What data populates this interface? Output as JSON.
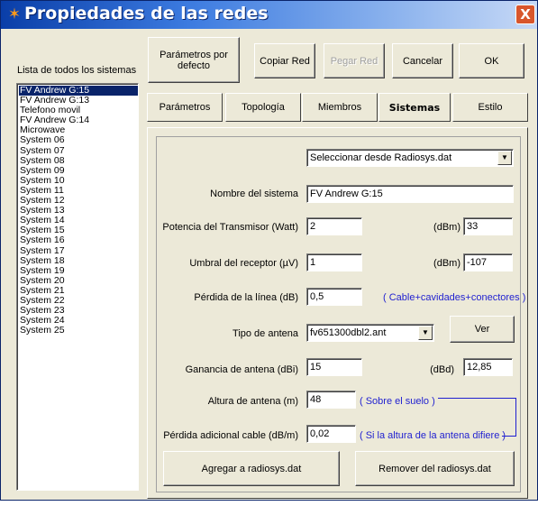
{
  "window": {
    "title": "Propiedades de las redes",
    "close_glyph": "X",
    "app_icon": "red-network-icon"
  },
  "toolbar": {
    "defaults_label": "Parámetros por defecto",
    "copy_label": "Copiar Red",
    "paste_label": "Pegar Red",
    "cancel_label": "Cancelar",
    "ok_label": "OK"
  },
  "systems_list": {
    "label": "Lista de todos los sistemas",
    "selected": "FV Andrew G:15",
    "items": [
      "FV Andrew G:15",
      "FV Andrew G:13",
      "Telefono movil",
      "FV Andrew G:14",
      "Microwave",
      "System 06",
      "System 07",
      "System 08",
      "System 09",
      "System 10",
      "System 11",
      "System 12",
      "System 13",
      "System 14",
      "System 15",
      "System 16",
      "System 17",
      "System 18",
      "System 19",
      "System 20",
      "System 21",
      "System 22",
      "System 23",
      "System 24",
      "System 25"
    ]
  },
  "tabs": [
    {
      "label": "Parámetros"
    },
    {
      "label": "Topología"
    },
    {
      "label": "Miembros"
    },
    {
      "label": "Sistemas",
      "active": true
    },
    {
      "label": "Estilo"
    }
  ],
  "form": {
    "source_select": "Seleccionar desde Radiosys.dat",
    "system_name_label": "Nombre del sistema",
    "system_name_value": "FV Andrew G:15",
    "tx_power_label": "Potencia del Transmisor (Watt)",
    "tx_power_watt": "2",
    "tx_power_dbm_label": "(dBm)",
    "tx_power_dbm": "33",
    "rx_threshold_label": "Umbral del receptor (µV)",
    "rx_threshold_uv": "1",
    "rx_threshold_dbm_label": "(dBm)",
    "rx_threshold_dbm": "-107",
    "line_loss_label": "Pérdida de la línea (dB)",
    "line_loss_value": "0,5",
    "line_loss_note": "( Cable+cavidades+conectores )",
    "antenna_type_label": "Tipo de antena",
    "antenna_type_value": "fv651300dbl2.ant",
    "view_label": "Ver",
    "antenna_gain_label": "Ganancia de antena (dBi)",
    "antenna_gain_dbi": "15",
    "antenna_gain_dbd_label": "(dBd)",
    "antenna_gain_dbd": "12,85",
    "antenna_height_label": "Altura de antena (m)",
    "antenna_height_value": "48",
    "antenna_height_note": "( Sobre el suelo )",
    "extra_loss_label": "Pérdida adicional cable (dB/m)",
    "extra_loss_value": "0,02",
    "extra_loss_note": "( Si la altura de la antena difiere )",
    "add_label": "Agregar a radiosys.dat",
    "remove_label": "Remover del radiosys.dat"
  },
  "colors": {
    "accent_blue": "#1f1fd0",
    "selection": "#0a246a",
    "title_start": "#0a3ea8"
  }
}
